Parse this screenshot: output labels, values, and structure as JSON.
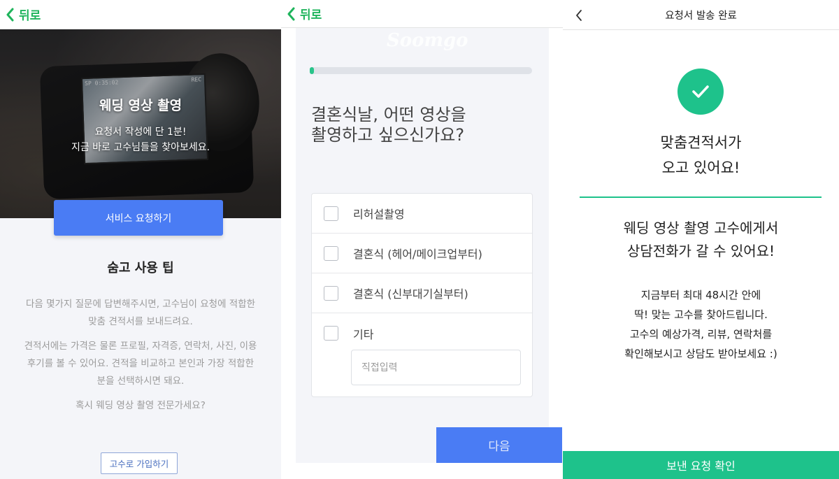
{
  "screen1": {
    "back_label": "뒤로",
    "hero_title": "웨딩 영상 촬영",
    "hero_sub_line1": "요청서 작성에 단 1분!",
    "hero_sub_line2": "지금 바로 고수님들을 찾아보세요.",
    "camera_hud_left": "SP  0:35:02",
    "camera_hud_right": "REC",
    "request_button": "서비스 요청하기",
    "tips_title": "숨고 사용 팁",
    "tip1_line1": "다음 몇가지 질문에 답변해주시면, 고수님이 요청에 적합한",
    "tip1_line2": "맞춤 견적서를 보내드려요.",
    "tip2_line1": "견적서에는 가격은 물론 프로필, 자격증, 연락처, 사진, 이용",
    "tip2_line2": "후기를 볼 수 있어요. 견적을 비교하고 본인과 가장 적합한",
    "tip2_line3": "분을 선택하시면 돼요.",
    "tip3": "혹시 웨딩 영상 촬영 전문가세요?",
    "join_button": "고수로 가입하기"
  },
  "screen2": {
    "back_label": "뒤로",
    "logo_watermark": "Soomgo",
    "progress_fraction": 0.02,
    "question_line1": "결혼식날, 어떤 영상을",
    "question_line2": "촬영하고 싶으신가요?",
    "options": [
      {
        "label": "리허설촬영"
      },
      {
        "label": "결혼식 (헤어/메이크업부터)"
      },
      {
        "label": "결혼식 (신부대기실부터)"
      },
      {
        "label": "기타"
      }
    ],
    "direct_input_placeholder": "직접입력",
    "next_button": "다음"
  },
  "screen3": {
    "header_title": "요청서 발송 완료",
    "done_line1": "맞춤견적서가",
    "done_line2": "오고 있어요!",
    "msg_line1": "웨딩 영상 촬영 고수에게서",
    "msg_line2": "상담전화가 갈 수 있어요!",
    "info_line1": "지금부터 최대 48시간 안에",
    "info_line2": "딱! 맞는 고수를 찾아드립니다.",
    "info_line3": "고수의 예상가격, 리뷰, 연락처를",
    "info_line4": "확인해보시고 상담도 받아보세요 :)",
    "confirm_button": "보낸 요청 확인"
  },
  "colors": {
    "green_accent": "#1fb45c",
    "teal_accent": "#1ec28b",
    "blue_button": "#4a7cf4"
  },
  "icons": [
    "chevron-left-icon",
    "checkmark-icon"
  ]
}
